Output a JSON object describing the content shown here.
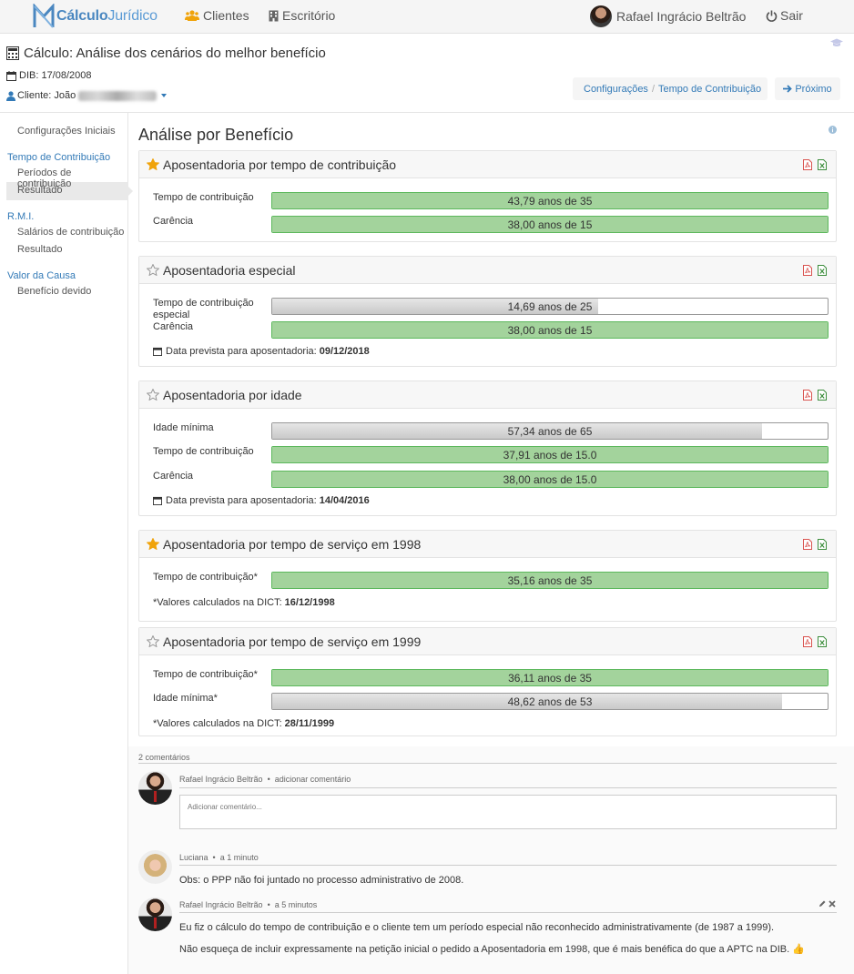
{
  "nav": {
    "brand_part1": "Cálculo",
    "brand_part2": "Jurídico",
    "clientes": "Clientes",
    "escritorio": "Escritório",
    "user_name": "Rafael Ingrácio Beltrão",
    "logout": "Sair"
  },
  "header": {
    "title": "Cálculo: Análise dos cenários do melhor benefício",
    "dib_label": "DIB: 17/08/2008",
    "cliente_label": "Cliente: João",
    "crumb_1": "Configurações",
    "crumb_sep": "/",
    "crumb_2": "Tempo de Contribuição",
    "next": "Próximo"
  },
  "sidebar": {
    "config_iniciais": "Configurações Iniciais",
    "tempo_contrib": "Tempo de Contribuição",
    "periodos": "Períodos de contribuição",
    "resultado1": "Resultado",
    "rmi": "R.M.I.",
    "salarios": "Salários de contribuição",
    "resultado2": "Resultado",
    "valor_causa": "Valor da Causa",
    "beneficio_devido": "Benefício devido"
  },
  "main": {
    "title": "Análise por Benefício",
    "cards": [
      {
        "title": "Aposentadoria por tempo de contribuição",
        "starred": true,
        "rows": [
          {
            "label": "Tempo de contribuição",
            "text": "43,79 anos de 35",
            "fill": 1.0,
            "color": "green"
          },
          {
            "label": "Carência",
            "text": "38,00 anos de 15",
            "fill": 1.0,
            "color": "green"
          }
        ]
      },
      {
        "title": "Aposentadoria especial",
        "starred": false,
        "rows": [
          {
            "label": "Tempo de contribuição especial",
            "text": "14,69 anos de 25",
            "fill": 0.5876,
            "color": "gray"
          },
          {
            "label": "Carência",
            "text": "38,00 anos de 15",
            "fill": 1.0,
            "color": "green"
          }
        ],
        "note_label": "Data prevista para aposentadoria:",
        "note_value": "09/12/2018"
      },
      {
        "title": "Aposentadoria por idade",
        "starred": false,
        "rows": [
          {
            "label": "Idade mínima",
            "text": "57,34 anos de 65",
            "fill": 0.8822,
            "color": "gray"
          },
          {
            "label": "Tempo de contribuição",
            "text": "37,91 anos de 15.0",
            "fill": 1.0,
            "color": "green"
          },
          {
            "label": "Carência",
            "text": "38,00 anos de 15.0",
            "fill": 1.0,
            "color": "green"
          }
        ],
        "note_label": "Data prevista para aposentadoria:",
        "note_value": "14/04/2016"
      },
      {
        "title": "Aposentadoria por tempo de serviço em 1998",
        "starred": true,
        "rows": [
          {
            "label": "Tempo de contribuição*",
            "text": "35,16 anos de 35",
            "fill": 1.0,
            "color": "green"
          }
        ],
        "note_label": "*Valores calculados na DICT:",
        "note_value": "16/12/1998"
      },
      {
        "title": "Aposentadoria por tempo de serviço em 1999",
        "starred": false,
        "rows": [
          {
            "label": "Tempo de contribuição*",
            "text": "36,11 anos de 35",
            "fill": 1.0,
            "color": "green"
          },
          {
            "label": "Idade mínima*",
            "text": "48,62 anos de 53",
            "fill": 0.9174,
            "color": "gray"
          }
        ],
        "note_label": "*Valores calculados na DICT:",
        "note_value": "28/11/1999"
      }
    ]
  },
  "comments": {
    "count": "2 comentários",
    "new_author": "Rafael Ingrácio Beltrão",
    "new_action": "adicionar comentário",
    "input_placeholder": "Adicionar comentário...",
    "dot": "•",
    "c1_author": "Luciana",
    "c1_time": "a 1 minuto",
    "c1_text": "Obs: o PPP não foi juntado no processo administrativo de 2008.",
    "c2_author": "Rafael Ingrácio Beltrão",
    "c2_time": "a 5 minutos",
    "c2_text1": "Eu fiz o cálculo do tempo de contribuição e o cliente tem um período especial não reconhecido administrativamente (de 1987 a 1999).",
    "c2_text2": "Não esqueça de incluir expressamente na petição inicial o pedido a Aposentadoria em 1998, que é mais benéfica do que a APTC na DIB.",
    "thumbs": "👍"
  },
  "colors": {
    "link": "#337ab7",
    "bar_green": "#a3d39c",
    "star": "#f0a30a",
    "pdf": "#d9534f",
    "excel": "#3c8d3c"
  }
}
